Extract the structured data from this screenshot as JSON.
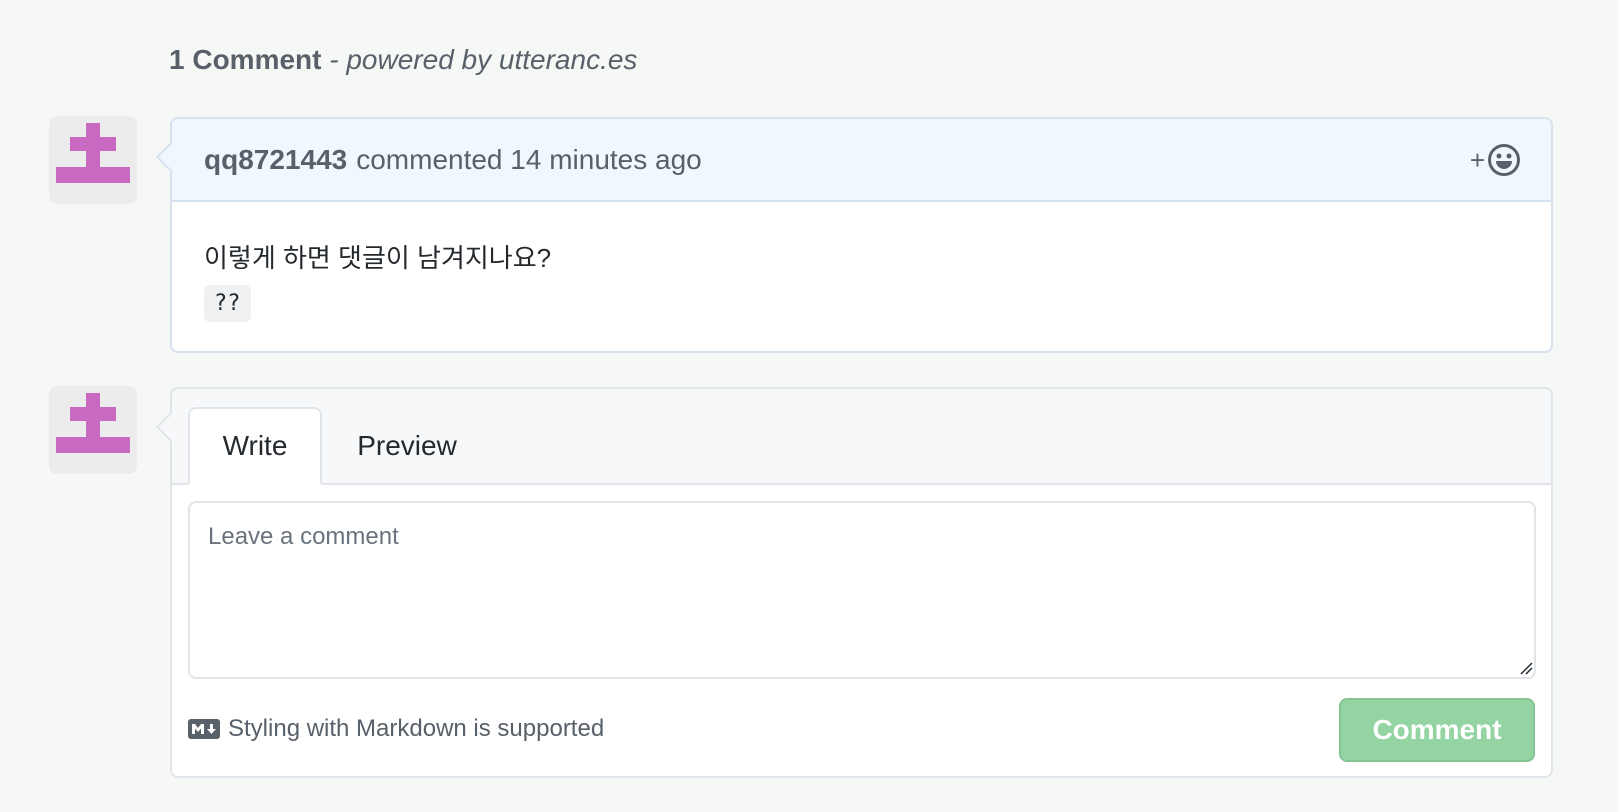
{
  "timeline_header": {
    "count_text": "1 Comment",
    "powered_text": "- powered by utteranc.es"
  },
  "comment": {
    "author": "qq8721443",
    "action_text": "commented 14 minutes ago",
    "reaction_plus": "+",
    "body_text": "이렇게 하면 댓글이 남겨지나요?",
    "body_code": "??"
  },
  "form": {
    "tab_write": "Write",
    "tab_preview": "Preview",
    "placeholder": "Leave a comment",
    "markdown_note": "Styling with Markdown is supported",
    "submit_label": "Comment"
  },
  "colors": {
    "avatar_glyph": "#c86ac2",
    "comment_header_bg": "#f0f7ff",
    "submit_disabled_bg": "#94d3a2"
  },
  "icons": {
    "reaction": "smiley-icon",
    "markdown": "markdown-icon"
  }
}
